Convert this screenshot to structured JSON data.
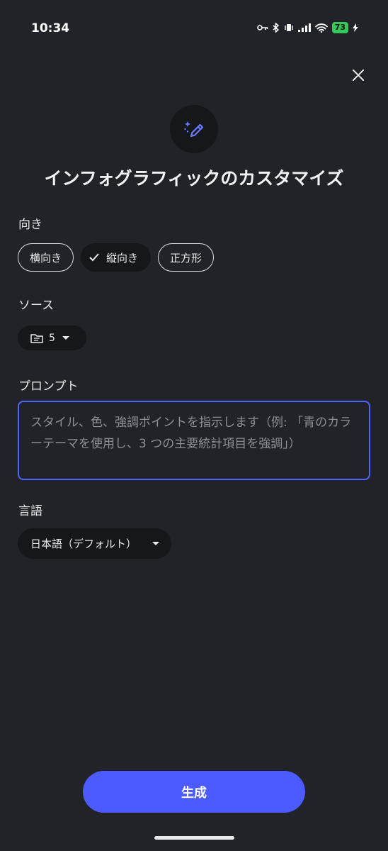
{
  "status_bar": {
    "time": "10:34",
    "battery": "73"
  },
  "title": "インフォグラフィックのカスタマイズ",
  "orientation": {
    "label": "向き",
    "options": [
      "横向き",
      "縦向き",
      "正方形"
    ],
    "selected": "縦向き"
  },
  "source": {
    "label": "ソース",
    "count": "5"
  },
  "prompt": {
    "label": "プロンプト",
    "placeholder": "スタイル、色、強調ポイントを指示します（例: 「青のカラーテーマを使用し、3 つの主要統計項目を強調」）"
  },
  "language": {
    "label": "言語",
    "value": "日本語（デフォルト）"
  },
  "generate_label": "生成",
  "colors": {
    "accent": "#4b5bff",
    "background": "#212328",
    "surface": "#15171b"
  }
}
